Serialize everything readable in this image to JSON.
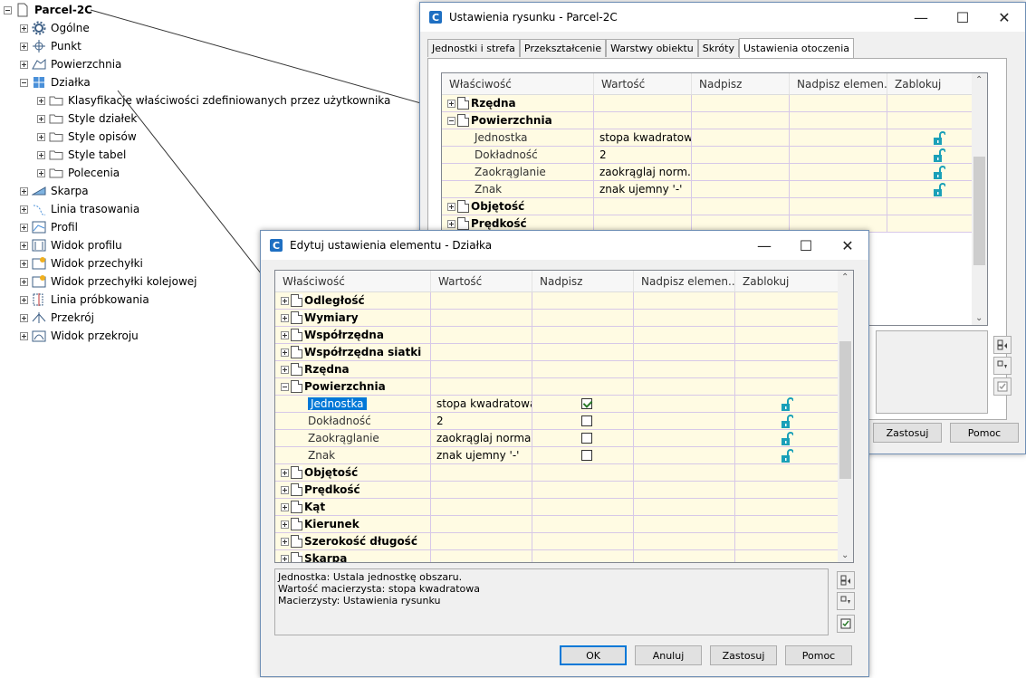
{
  "tree": {
    "root": "Parcel-2C",
    "items": [
      {
        "label": "Ogólne",
        "icon": "gear-icon",
        "depth": 1,
        "exp": "plus"
      },
      {
        "label": "Punkt",
        "icon": "point-icon",
        "depth": 1,
        "exp": "plus"
      },
      {
        "label": "Powierzchnia",
        "icon": "surface-icon",
        "depth": 1,
        "exp": "plus"
      },
      {
        "label": "Działka",
        "icon": "parcel-icon",
        "depth": 1,
        "exp": "minus"
      },
      {
        "label": "Klasyfikacje właściwości zdefiniowanych przez użytkownika",
        "icon": "folder-icon",
        "depth": 2,
        "exp": "plus"
      },
      {
        "label": "Style działek",
        "icon": "folder-icon",
        "depth": 2,
        "exp": "plus"
      },
      {
        "label": "Style opisów",
        "icon": "folder-icon",
        "depth": 2,
        "exp": "plus"
      },
      {
        "label": "Style tabel",
        "icon": "folder-icon",
        "depth": 2,
        "exp": "plus"
      },
      {
        "label": "Polecenia",
        "icon": "folder-icon",
        "depth": 2,
        "exp": "plus"
      },
      {
        "label": "Skarpa",
        "icon": "grading-icon",
        "depth": 1,
        "exp": "plus"
      },
      {
        "label": "Linia trasowania",
        "icon": "alignment-icon",
        "depth": 1,
        "exp": "plus"
      },
      {
        "label": "Profil",
        "icon": "profile-icon",
        "depth": 1,
        "exp": "plus"
      },
      {
        "label": "Widok profilu",
        "icon": "profile-view-icon",
        "depth": 1,
        "exp": "plus"
      },
      {
        "label": "Widok przechyłki",
        "icon": "superelevation-icon",
        "depth": 1,
        "exp": "plus"
      },
      {
        "label": "Widok przechyłki kolejowej",
        "icon": "cant-view-icon",
        "depth": 1,
        "exp": "plus"
      },
      {
        "label": "Linia próbkowania",
        "icon": "sample-line-icon",
        "depth": 1,
        "exp": "plus"
      },
      {
        "label": "Przekrój",
        "icon": "section-icon",
        "depth": 1,
        "exp": "plus"
      },
      {
        "label": "Widok przekroju",
        "icon": "section-view-icon",
        "depth": 1,
        "exp": "plus"
      }
    ]
  },
  "back_dialog": {
    "title": "Ustawienia rysunku - Parcel-2C",
    "tabs": [
      "Jednostki i strefa",
      "Przekształcenie",
      "Warstwy obiektu",
      "Skróty",
      "Ustawienia otoczenia"
    ],
    "columns": [
      "Właściwość",
      "Wartość",
      "Nadpisz",
      "Nadpisz elemen...",
      "Zablokuj"
    ],
    "rows": [
      {
        "prop": "Rzędna",
        "value": "",
        "group": true,
        "exp": "plus"
      },
      {
        "prop": "Powierzchnia",
        "value": "",
        "group": true,
        "exp": "minus"
      },
      {
        "prop": "Jednostka",
        "value": "stopa kwadratowa",
        "group": false,
        "lock": true
      },
      {
        "prop": "Dokładność",
        "value": "2",
        "group": false,
        "lock": true
      },
      {
        "prop": "Zaokrąglanie",
        "value": "zaokrąglaj norm...",
        "group": false,
        "lock": true
      },
      {
        "prop": "Znak",
        "value": "znak ujemny '-'",
        "group": false,
        "lock": true
      },
      {
        "prop": "Objętość",
        "value": "",
        "group": true,
        "exp": "plus"
      },
      {
        "prop": "Prędkość",
        "value": "",
        "group": true,
        "exp": "plus"
      }
    ],
    "buttons": {
      "apply": "Zastosuj",
      "help": "Pomoc"
    }
  },
  "front_dialog": {
    "title": "Edytuj ustawienia elementu - Działka",
    "columns": [
      "Właściwość",
      "Wartość",
      "Nadpisz",
      "Nadpisz elemen...",
      "Zablokuj"
    ],
    "rows": [
      {
        "prop": "Odległość",
        "value": "",
        "group": true,
        "exp": "plus"
      },
      {
        "prop": "Wymiary",
        "value": "",
        "group": true,
        "exp": "plus"
      },
      {
        "prop": "Współrzędna",
        "value": "",
        "group": true,
        "exp": "plus"
      },
      {
        "prop": "Współrzędna siatki",
        "value": "",
        "group": true,
        "exp": "plus"
      },
      {
        "prop": "Rzędna",
        "value": "",
        "group": true,
        "exp": "plus"
      },
      {
        "prop": "Powierzchnia",
        "value": "",
        "group": true,
        "exp": "minus"
      },
      {
        "prop": "Jednostka",
        "value": "stopa kwadratowa",
        "group": false,
        "check": true,
        "selected": true,
        "lock": true
      },
      {
        "prop": "Dokładność",
        "value": "2",
        "group": false,
        "check": false,
        "lock": true
      },
      {
        "prop": "Zaokrąglanie",
        "value": "zaokrąglaj norma...",
        "group": false,
        "check": false,
        "lock": true
      },
      {
        "prop": "Znak",
        "value": "znak ujemny '-'",
        "group": false,
        "check": false,
        "lock": true
      },
      {
        "prop": "Objętość",
        "value": "",
        "group": true,
        "exp": "plus"
      },
      {
        "prop": "Prędkość",
        "value": "",
        "group": true,
        "exp": "plus"
      },
      {
        "prop": "Kąt",
        "value": "",
        "group": true,
        "exp": "plus"
      },
      {
        "prop": "Kierunek",
        "value": "",
        "group": true,
        "exp": "plus"
      },
      {
        "prop": "Szerokość długość",
        "value": "",
        "group": true,
        "exp": "plus"
      },
      {
        "prop": "Skarpa",
        "value": "",
        "group": true,
        "exp": "plus"
      }
    ],
    "description": [
      "Jednostka: Ustala jednostkę obszaru.",
      "Wartość macierzysta: stopa kwadratowa",
      "Macierzysty: Ustawienia rysunku"
    ],
    "buttons": {
      "ok": "OK",
      "cancel": "Anuluj",
      "apply": "Zastosuj",
      "help": "Pomoc"
    }
  },
  "colors": {
    "row_bg": "#fffbe3",
    "row_line": "#d7c8e8",
    "selection": "#0078d7",
    "lock": "#1aa0b8"
  }
}
